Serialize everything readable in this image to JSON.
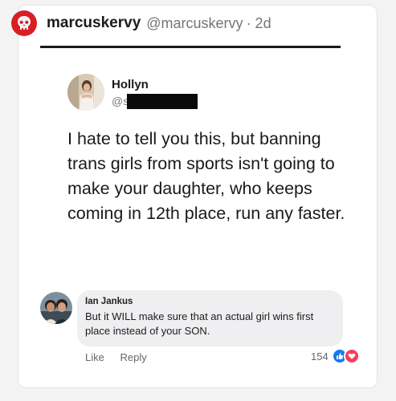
{
  "post": {
    "username": "marcuskervy",
    "handle": "@marcuskervy",
    "timestamp": "· 2d",
    "avatar_icon": "punisher-skull-icon",
    "accent_color": "#d81f26"
  },
  "tweet": {
    "author_name": "Hollyn",
    "author_handle": "@s",
    "text": "I hate to tell you this, but banning trans girls from sports isn't going to make your daughter, who keeps coming in 12th place, run any faster."
  },
  "comment": {
    "author": "Ian Jankus",
    "text": "But it WILL make sure that an actual girl wins first place instead of your SON.",
    "actions": {
      "like": "Like",
      "reply": "Reply"
    },
    "reaction_count": "154",
    "reaction_icons": [
      "like-icon",
      "love-icon"
    ]
  }
}
